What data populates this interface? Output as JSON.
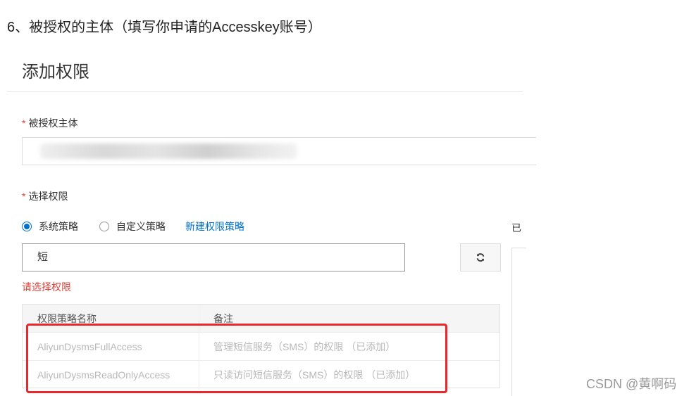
{
  "step_heading": "6、被授权的主体（填写你申请的Accesskey账号）",
  "dialog": {
    "title": "添加权限",
    "principal": {
      "required_mark": "*",
      "label": "被授权主体",
      "value": ""
    },
    "permission": {
      "required_mark": "*",
      "label": "选择权限"
    },
    "policy_type": {
      "options": [
        {
          "label": "系统策略",
          "checked": true
        },
        {
          "label": "自定义策略",
          "checked": false
        }
      ],
      "new_policy_link": "新建权限策略"
    },
    "selected_panel_label_cut": "已",
    "search": {
      "value": "短"
    },
    "refresh_icon": "refresh-icon",
    "error": "请选择权限",
    "table": {
      "columns": [
        "权限策略名称",
        "备注"
      ],
      "rows": [
        {
          "name": "AliyunDysmsFullAccess",
          "note": "管理短信服务（SMS）的权限 （已添加）"
        },
        {
          "name": "AliyunDysmsReadOnlyAccess",
          "note": "只读访问短信服务（SMS）的权限 （已添加）"
        }
      ]
    }
  },
  "colors": {
    "accent": "#0070cc",
    "error": "#e0413a",
    "annotation_box": "#e8282b"
  },
  "watermark": "CSDN @黄啊码"
}
